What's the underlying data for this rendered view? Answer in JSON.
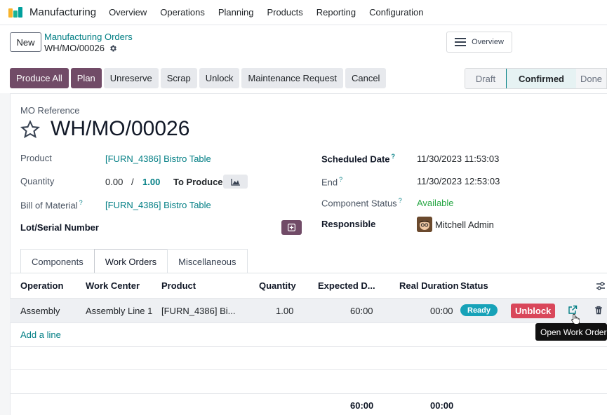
{
  "app": {
    "name": "Manufacturing",
    "logo_colors": [
      "#f7b32b",
      "#1ab394",
      "#00a09d"
    ]
  },
  "nav": [
    "Overview",
    "Operations",
    "Planning",
    "Products",
    "Reporting",
    "Configuration"
  ],
  "control_panel": {
    "new_label": "New",
    "breadcrumb_parent": "Manufacturing Orders",
    "breadcrumb_current": "WH/MO/00026",
    "overview_label": "Overview"
  },
  "actions": {
    "produce_all": "Produce All",
    "plan": "Plan",
    "unreserve": "Unreserve",
    "scrap": "Scrap",
    "unlock": "Unlock",
    "maintenance_request": "Maintenance Request",
    "cancel": "Cancel"
  },
  "statusbar": {
    "draft": "Draft",
    "confirmed": "Confirmed",
    "done": "Done",
    "active": "Confirmed"
  },
  "form": {
    "ref_label": "MO Reference",
    "title": "WH/MO/00026",
    "product_label": "Product",
    "product_value": "[FURN_4386] Bistro Table",
    "quantity_label": "Quantity",
    "qty_produced": "0.00",
    "qty_sep": "/",
    "qty_total": "1.00",
    "to_produce": "To Produce",
    "bom_label": "Bill of Material",
    "bom_value": "[FURN_4386] Bistro Table",
    "lot_label": "Lot/Serial Number",
    "scheduled_label": "Scheduled Date",
    "scheduled_value": "11/30/2023 11:53:03",
    "end_label": "End",
    "end_value": "11/30/2023 12:53:03",
    "component_status_label": "Component Status",
    "component_status_value": "Available",
    "responsible_label": "Responsible",
    "responsible_value": "Mitchell Admin",
    "help_mark": "?"
  },
  "tabs": [
    {
      "label": "Components",
      "active": false
    },
    {
      "label": "Work Orders",
      "active": true
    },
    {
      "label": "Miscellaneous",
      "active": false
    }
  ],
  "table": {
    "headers": {
      "operation": "Operation",
      "work_center": "Work Center",
      "product": "Product",
      "quantity": "Quantity",
      "expected": "Expected D...",
      "real": "Real Duration",
      "status": "Status"
    },
    "rows": [
      {
        "operation": "Assembly",
        "work_center": "Assembly Line 1",
        "product": "[FURN_4386] Bi...",
        "quantity": "1.00",
        "expected": "60:00",
        "real": "00:00",
        "status": "Ready",
        "unblock": "Unblock"
      }
    ],
    "add_line": "Add a line",
    "totals": {
      "expected": "60:00",
      "real": "00:00"
    }
  },
  "tooltip": "Open Work Order"
}
